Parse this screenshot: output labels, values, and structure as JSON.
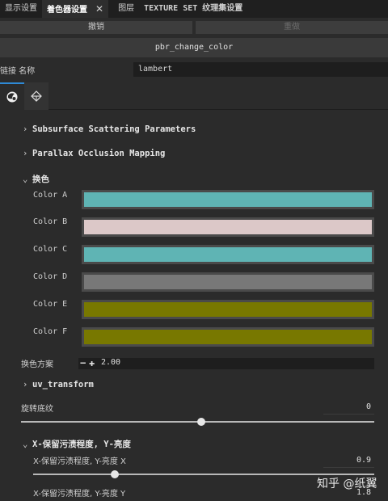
{
  "tabs": [
    {
      "label": "显示设置"
    },
    {
      "label": "着色器设置"
    },
    {
      "label": "图层"
    },
    {
      "label": "TEXTURE SET 纹理集设置"
    }
  ],
  "tab_close": "✕",
  "toolbar": {
    "undo_label": "撤销",
    "redo_label": "重做"
  },
  "shader_name": "pbr_change_color",
  "name_row": {
    "label": "链接 名称",
    "value": "lambert"
  },
  "sections": {
    "subsurface": "Subsurface Scattering Parameters",
    "parallax": "Parallax Occlusion Mapping",
    "swap_color": "换色",
    "uv_transform": "uv_transform",
    "x_retention": "X-保留污渍程度, Y-亮度"
  },
  "colors": [
    {
      "label": "Color A",
      "hex": "#5fb4b4"
    },
    {
      "label": "Color B",
      "hex": "#dcc8c8"
    },
    {
      "label": "Color C",
      "hex": "#5fb4b4"
    },
    {
      "label": "Color D",
      "hex": "#787878"
    },
    {
      "label": "Color E",
      "hex": "#787800"
    },
    {
      "label": "Color F",
      "hex": "#787800"
    }
  ],
  "swap_scheme": {
    "label": "换色方案",
    "value": "2.00",
    "minus": "−",
    "plus": "✚"
  },
  "rotate": {
    "label": "旋转底纹",
    "value": "0",
    "fraction": 0.51
  },
  "x_param": {
    "label": "X-保留污渍程度, Y-亮度 X",
    "value": "0.9",
    "fraction": 0.24
  },
  "y_param": {
    "label": "X-保留污渍程度, Y-亮度 Y",
    "value": "1.8"
  },
  "watermark": "知乎 @纸翼",
  "icons": {
    "material": "material-sphere-icon",
    "geometry": "geometry-icon"
  }
}
